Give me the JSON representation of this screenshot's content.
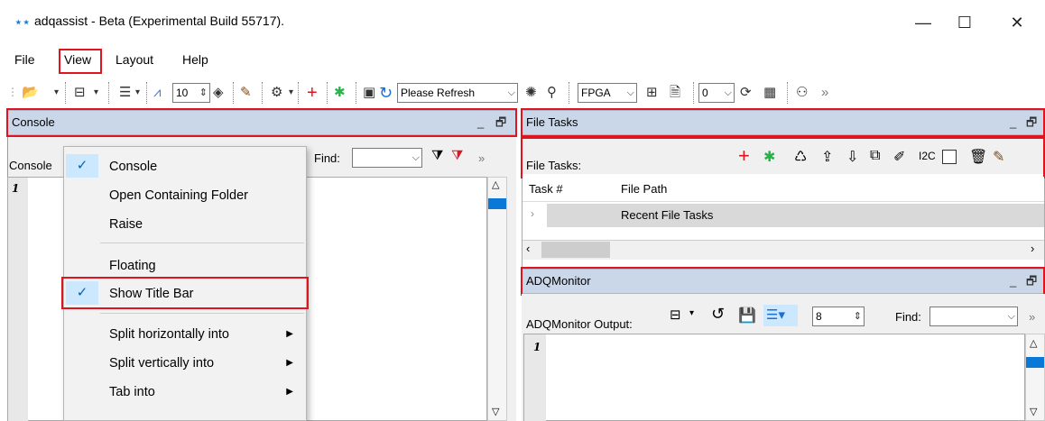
{
  "window": {
    "title": "adqassist - Beta (Experimental Build 55717).",
    "minimize": "—",
    "maximize": "☐",
    "close": "✕"
  },
  "menu": {
    "file": "File",
    "view": "View",
    "layout": "Layout",
    "help": "Help"
  },
  "toolbar": {
    "spin_value": "10",
    "refresh_combo": "Please Refresh",
    "fpga_combo": "FPGA",
    "small_combo": "0",
    "more": "»"
  },
  "console_panel": {
    "title": "Console",
    "label": "Console",
    "find_label": "Find:",
    "line_number": "1",
    "more": "»"
  },
  "context_menu": {
    "items": [
      {
        "label": "Console",
        "checked": true
      },
      {
        "label": "Open Containing Folder"
      },
      {
        "label": "Raise"
      },
      {
        "label": "Floating"
      },
      {
        "label": "Show Title Bar",
        "checked": true
      },
      {
        "label": "Split horizontally into",
        "submenu": true
      },
      {
        "label": "Split vertically into",
        "submenu": true
      },
      {
        "label": "Tab into",
        "submenu": true
      }
    ]
  },
  "filetasks_panel": {
    "title": "File Tasks",
    "label": "File Tasks:",
    "i2c_label": "I2C",
    "columns": [
      "Task #",
      "File Path"
    ],
    "rows": [
      {
        "label": "Recent File Tasks"
      }
    ]
  },
  "adqmonitor_panel": {
    "title": "ADQMonitor",
    "label": "ADQMonitor Output:",
    "spin_value": "8",
    "find_label": "Find:",
    "line_number": "1",
    "more": "»"
  },
  "colors": {
    "panel_header": "#c9d7e8",
    "highlight_border": "#e0141e",
    "menu_check_bg": "#cce8ff",
    "scroll_thumb": "#0a78d7"
  }
}
